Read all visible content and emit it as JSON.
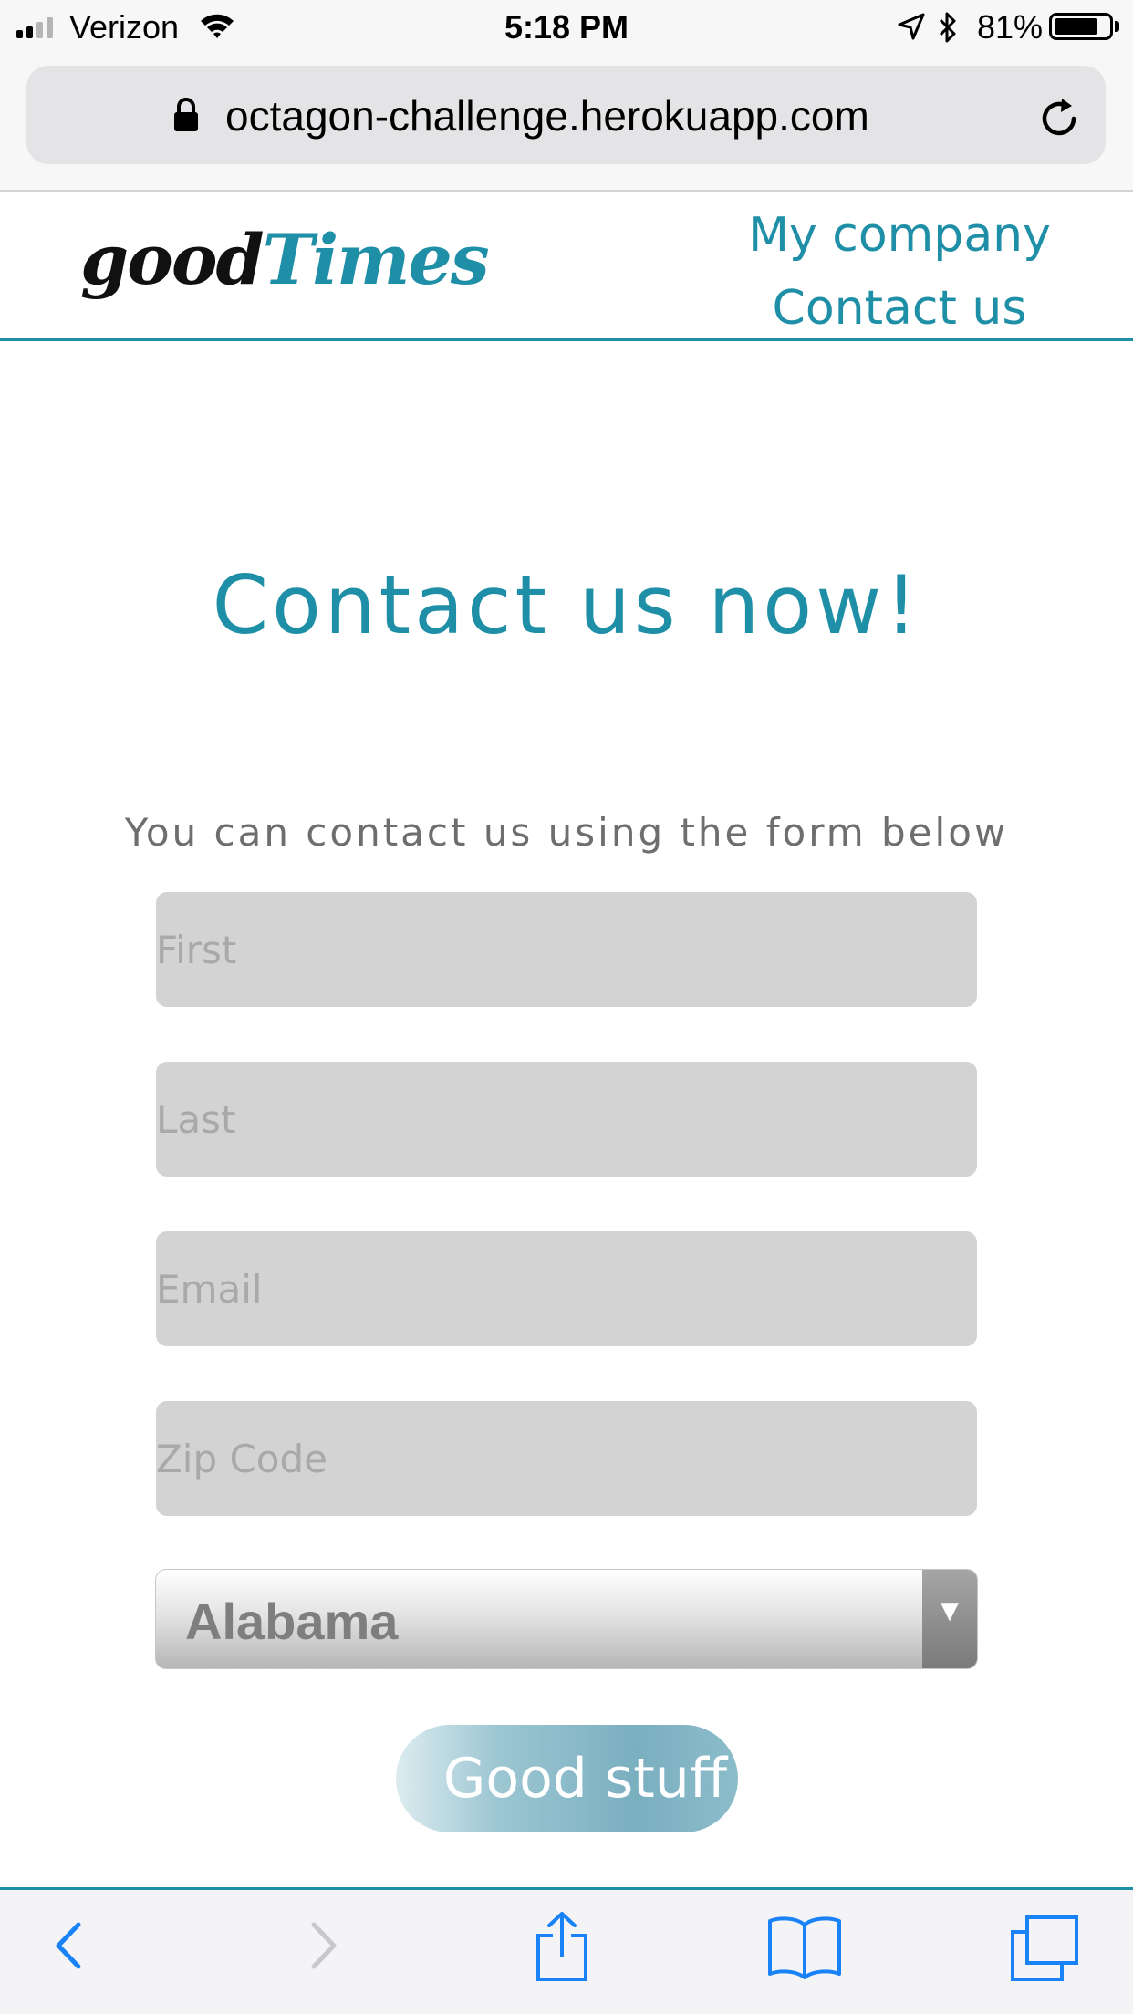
{
  "status_bar": {
    "carrier": "Verizon",
    "time": "5:18 PM",
    "battery_percent": "81%",
    "battery_level": 0.81,
    "icons": [
      "signal-icon",
      "wifi-icon",
      "location-arrow-icon",
      "bluetooth-icon",
      "battery-icon"
    ]
  },
  "browser": {
    "url": "octagon-challenge.herokuapp.com",
    "icons": [
      "lock-icon",
      "reload-icon"
    ],
    "toolbar_icons": [
      "back-icon",
      "forward-icon",
      "share-icon",
      "bookmarks-icon",
      "tabs-icon"
    ]
  },
  "header": {
    "logo_part1": "good",
    "logo_part2": "Times",
    "nav": [
      {
        "label": "My company"
      },
      {
        "label": "Contact us"
      }
    ]
  },
  "main": {
    "title": "Contact us now!",
    "subtitle": "You can contact us using the form below"
  },
  "form": {
    "first_placeholder": "First",
    "last_placeholder": "Last",
    "email_placeholder": "Email",
    "zip_placeholder": "Zip Code",
    "state_value": "Alabama",
    "submit_label": "Good stuff"
  },
  "colors": {
    "accent": "#1e8fa6",
    "field_bg": "#d3d3d3",
    "placeholder": "#a9a9a9",
    "subtitle": "#6e6e6e"
  }
}
